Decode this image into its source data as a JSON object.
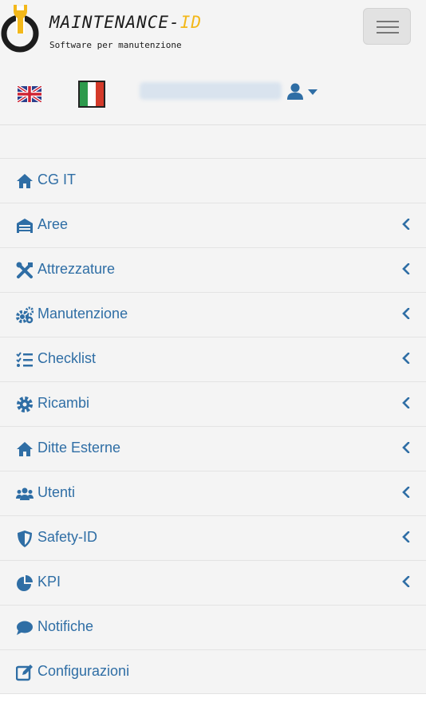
{
  "brand": {
    "title_main": "MAINTENANCE-",
    "title_accent": "ID",
    "subtitle": "Software per manutenzione",
    "logo_icon": "wrench-power-icon",
    "accent_color": "#f3b81a"
  },
  "header": {
    "menu_toggle_icon": "hamburger-icon"
  },
  "languages": [
    {
      "code": "en",
      "icon": "uk-flag-icon"
    },
    {
      "code": "it",
      "icon": "italy-flag-icon",
      "selected": true
    }
  ],
  "user": {
    "icon": "user-icon",
    "dropdown_icon": "caret-down-icon"
  },
  "menu": {
    "link_color": "#2f6ea5",
    "items": [
      {
        "label": "CG IT",
        "icon": "home-icon",
        "has_submenu": false
      },
      {
        "label": "Aree",
        "icon": "warehouse-icon",
        "has_submenu": true
      },
      {
        "label": "Attrezzature",
        "icon": "tools-icon",
        "has_submenu": true
      },
      {
        "label": "Manutenzione",
        "icon": "cogs-icon",
        "has_submenu": true
      },
      {
        "label": "Checklist",
        "icon": "tasks-icon",
        "has_submenu": true
      },
      {
        "label": "Ricambi",
        "icon": "cog-icon",
        "has_submenu": true
      },
      {
        "label": "Ditte Esterne",
        "icon": "home-icon",
        "has_submenu": true
      },
      {
        "label": "Utenti",
        "icon": "users-icon",
        "has_submenu": true
      },
      {
        "label": "Safety-ID",
        "icon": "shield-icon",
        "has_submenu": true
      },
      {
        "label": "KPI",
        "icon": "pie-chart-icon",
        "has_submenu": true
      },
      {
        "label": "Notifiche",
        "icon": "comment-icon",
        "has_submenu": false
      },
      {
        "label": "Configurazioni",
        "icon": "edit-icon",
        "has_submenu": false
      }
    ]
  }
}
